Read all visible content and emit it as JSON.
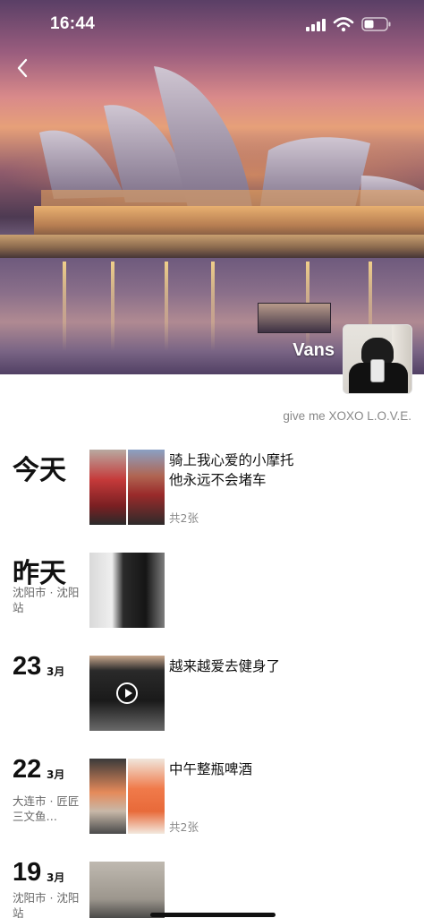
{
  "status_bar": {
    "time": "16:44",
    "icons": [
      "signal-icon",
      "wifi-icon",
      "battery-icon"
    ]
  },
  "nav": {
    "back_icon": "chevron-left-icon"
  },
  "profile": {
    "username": "Vans",
    "signature": "give me XOXO L.O.V.E."
  },
  "feed": [
    {
      "day_label": "今天",
      "text": "骑上我心爱的小摩托\n他永远不会堵车",
      "count": "共2张"
    },
    {
      "day_label": "昨天",
      "location": "沈阳市 · 沈阳站"
    },
    {
      "day": "23",
      "month": "3月",
      "text": "越来越爱去健身了",
      "has_video": true
    },
    {
      "day": "22",
      "month": "3月",
      "location": "大连市 · 匠匠三文鱼…",
      "text": "中午整瓶啤酒",
      "count": "共2张"
    },
    {
      "day": "19",
      "month": "3月",
      "location": "沈阳市 · 沈阳站"
    }
  ],
  "colors": {
    "text_primary": "#111111",
    "text_secondary": "#888888",
    "location_text": "#666666"
  }
}
